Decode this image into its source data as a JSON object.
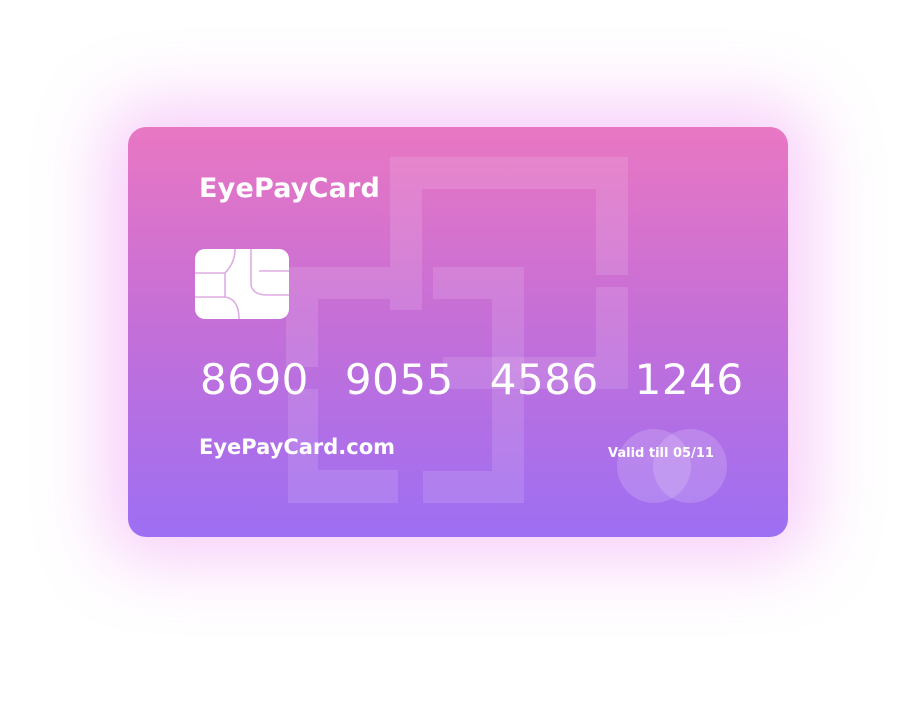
{
  "card": {
    "brand": "EyePayCard",
    "number_groups": [
      "8690",
      "9055",
      "4586",
      "1246"
    ],
    "website": "EyePayCard.com",
    "valid_label": "Valid till 05/11"
  },
  "colors": {
    "gradient_top": "#e977c3",
    "gradient_middle": "#c76fd6",
    "gradient_bottom": "#9d6ff3",
    "glow": "#e978f0",
    "text": "#ffffff"
  },
  "icons": {
    "chip": "chip-icon",
    "network_logo": "card-network-logo",
    "background_pattern": "brand-watermark"
  }
}
